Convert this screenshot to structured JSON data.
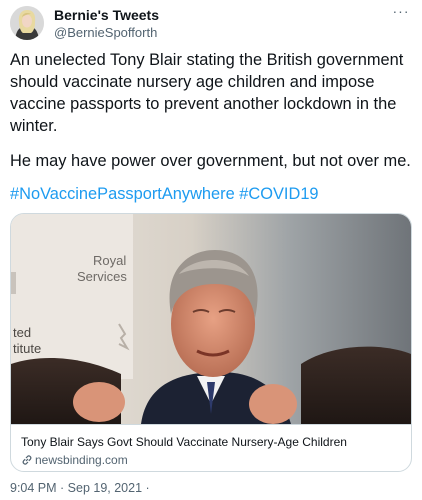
{
  "author": {
    "display_name": "Bernie's Tweets",
    "handle": "@BernieSpofforth"
  },
  "menu": {
    "more_glyph": "···"
  },
  "tweet": {
    "line1": "An unelected Tony Blair stating the British government",
    "line2": "should vaccinate nursery age children and impose",
    "line3": "vaccine passports to prevent another lockdown in the",
    "line4": "winter.",
    "paragraph2": "He may have power over government, but not over me.",
    "hashtags": [
      "#NoVaccinePassportAnywhere",
      "#COVID19"
    ]
  },
  "link_card": {
    "image_text": {
      "sign_line1": "Royal",
      "sign_line2": "Services",
      "left_line1": "ted",
      "left_line2": "titute"
    },
    "title": "Tony Blair Says Govt Should Vaccinate Nursery-Age Children",
    "domain": "newsbinding.com",
    "domain_icon": "link-icon"
  },
  "timestamp": "9:04 PM · Sep 19, 2021 ·",
  "colors": {
    "text": "#0f1419",
    "secondary": "#536471",
    "link": "#1d9bf0",
    "border": "#cfd9de"
  }
}
